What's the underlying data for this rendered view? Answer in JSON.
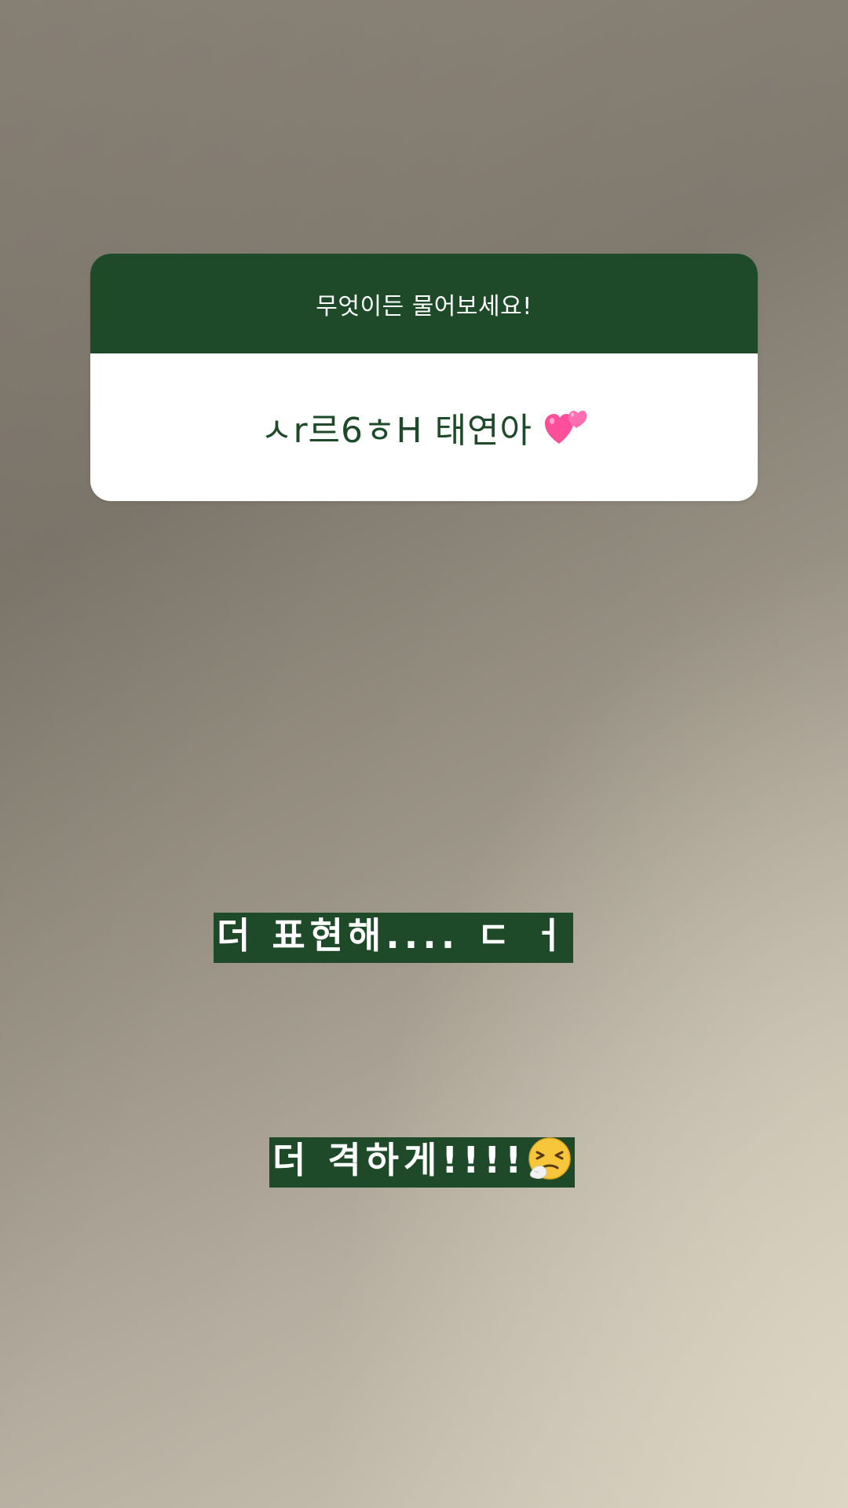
{
  "story": {
    "question_sticker": {
      "header": "무엇이든 물어보세요!",
      "answer": "ㅅr르6ㅎH 태연아",
      "answer_icon": "two-hearts-icon"
    },
    "captions": [
      {
        "text": "더 표현해.... ㄷ ㅓ"
      },
      {
        "text": "더 격하게!!!!",
        "icon": "sneezing-face-icon"
      }
    ],
    "colors": {
      "accent_green": "#1e4a2a",
      "card_background": "#ffffff",
      "heart_pink": "#ff4f9a"
    }
  }
}
